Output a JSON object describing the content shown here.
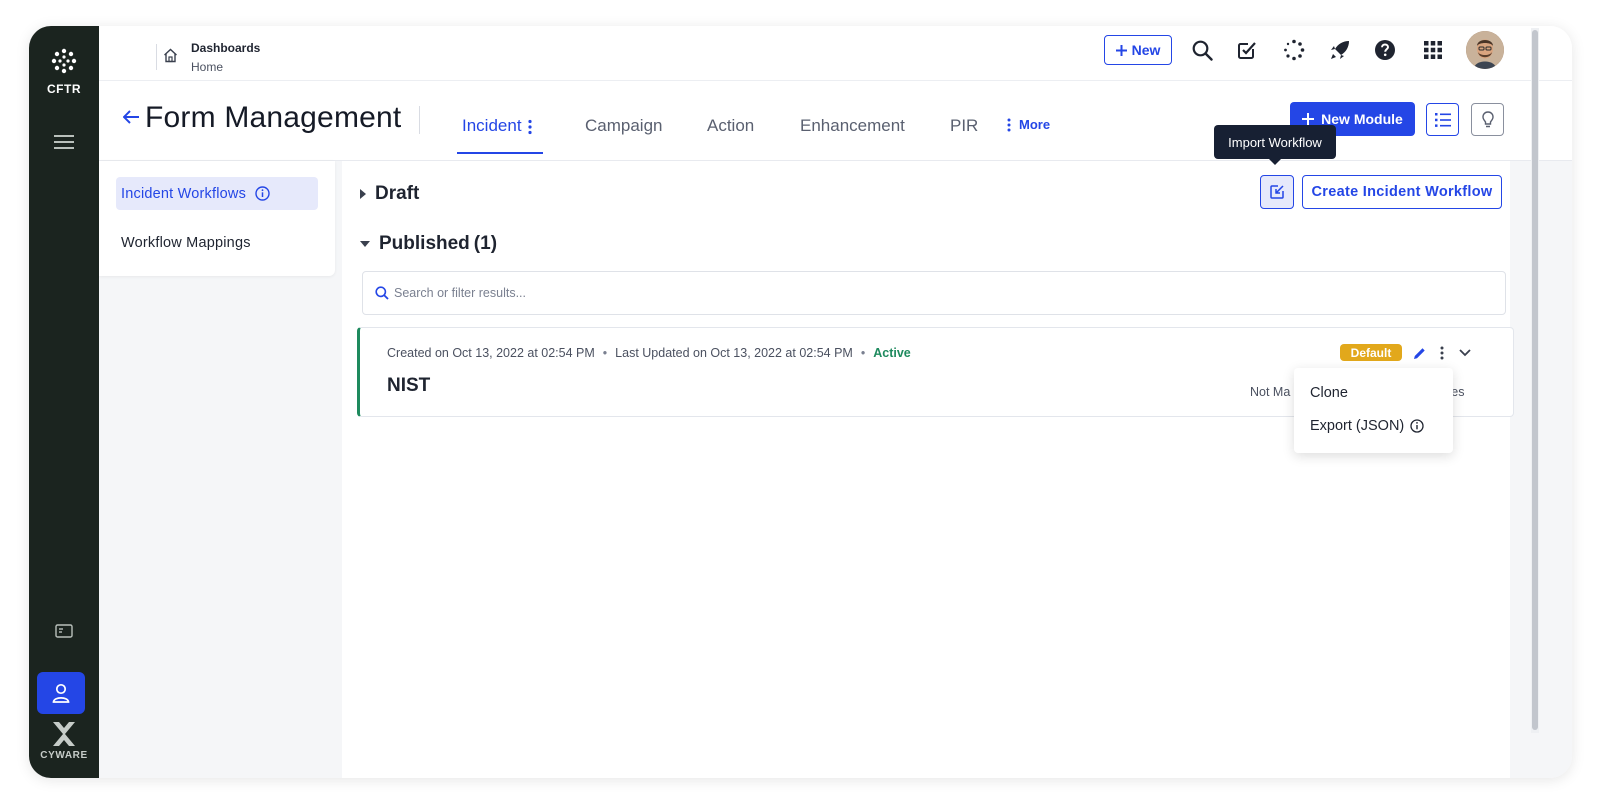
{
  "app": {
    "name": "CFTR",
    "brand": "CYWARE"
  },
  "topbar": {
    "breadcrumb": {
      "parent": "Dashboards",
      "current": "Home"
    },
    "new_label": "New",
    "icons": [
      "search-icon",
      "tasks-check-icon",
      "loading-spinner-icon",
      "rocket-icon",
      "help-icon",
      "apps-grid-icon"
    ]
  },
  "header": {
    "title": "Form Management",
    "tabs": [
      {
        "label": "Incident",
        "active": true
      },
      {
        "label": "Campaign",
        "active": false
      },
      {
        "label": "Action",
        "active": false
      },
      {
        "label": "Enhancement",
        "active": false
      },
      {
        "label": "PIR",
        "active": false
      }
    ],
    "more_label": "More",
    "new_module_label": "New Module"
  },
  "sidebar": {
    "items": [
      {
        "label": "Incident Workflows",
        "active": true
      },
      {
        "label": "Workflow Mappings",
        "active": false
      }
    ]
  },
  "main": {
    "draft_label": "Draft",
    "published_label": "Published",
    "published_count": "(1)",
    "import_tooltip": "Import Workflow",
    "create_button_label": "Create Incident Workflow",
    "search_placeholder": "Search or filter results...",
    "workflow": {
      "created": "Created on Oct 13, 2022 at 02:54 PM",
      "updated": "Last Updated on Oct 13, 2022 at 02:54 PM",
      "status": "Active",
      "name": "NIST",
      "badge": "Default",
      "mapping_prefix": "Not Ma",
      "mapping_suffix": "ses"
    },
    "menu": [
      {
        "label": "Clone"
      },
      {
        "label": "Export (JSON)"
      }
    ]
  },
  "colors": {
    "accent": "#2446e6",
    "rail": "#1b241f",
    "active_green": "#1e8a5e",
    "badge_yellow": "#e2a81b",
    "tooltip_bg": "#172033"
  }
}
